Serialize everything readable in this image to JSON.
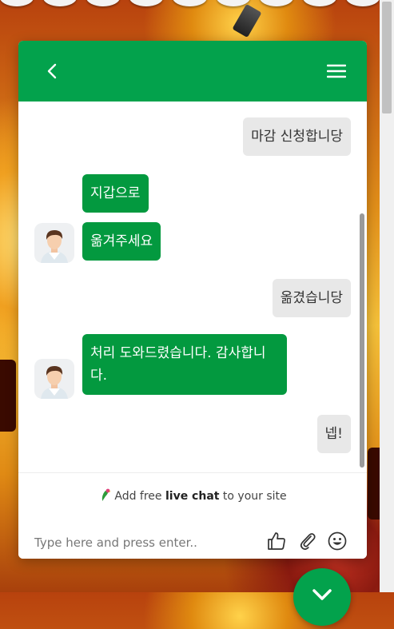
{
  "messages": [
    {
      "from": "visitor",
      "text": "마감 신청합니당"
    },
    {
      "from": "agent",
      "text": "지갑으로"
    },
    {
      "from": "agent",
      "text": "옮겨주세요"
    },
    {
      "from": "visitor",
      "text": "옮겼습니당"
    },
    {
      "from": "agent",
      "text": "처리 도와드렸습니다. 감사합니다."
    },
    {
      "from": "visitor",
      "text": "넵!"
    }
  ],
  "footer": {
    "brand_prefix": "Add free ",
    "brand_bold": "live chat",
    "brand_suffix": " to your site",
    "input_placeholder": "Type here and press enter.."
  },
  "colors": {
    "header": "#03a24c",
    "agent_bubble": "#03993f",
    "visitor_bubble": "#e8e8e8"
  },
  "icons": {
    "header_left": "back-chevron-icon",
    "header_right": "hamburger-menu-icon",
    "tools": [
      "thumbs-up-icon",
      "paperclip-icon",
      "emoji-icon"
    ],
    "fab": "chevron-down-icon"
  }
}
